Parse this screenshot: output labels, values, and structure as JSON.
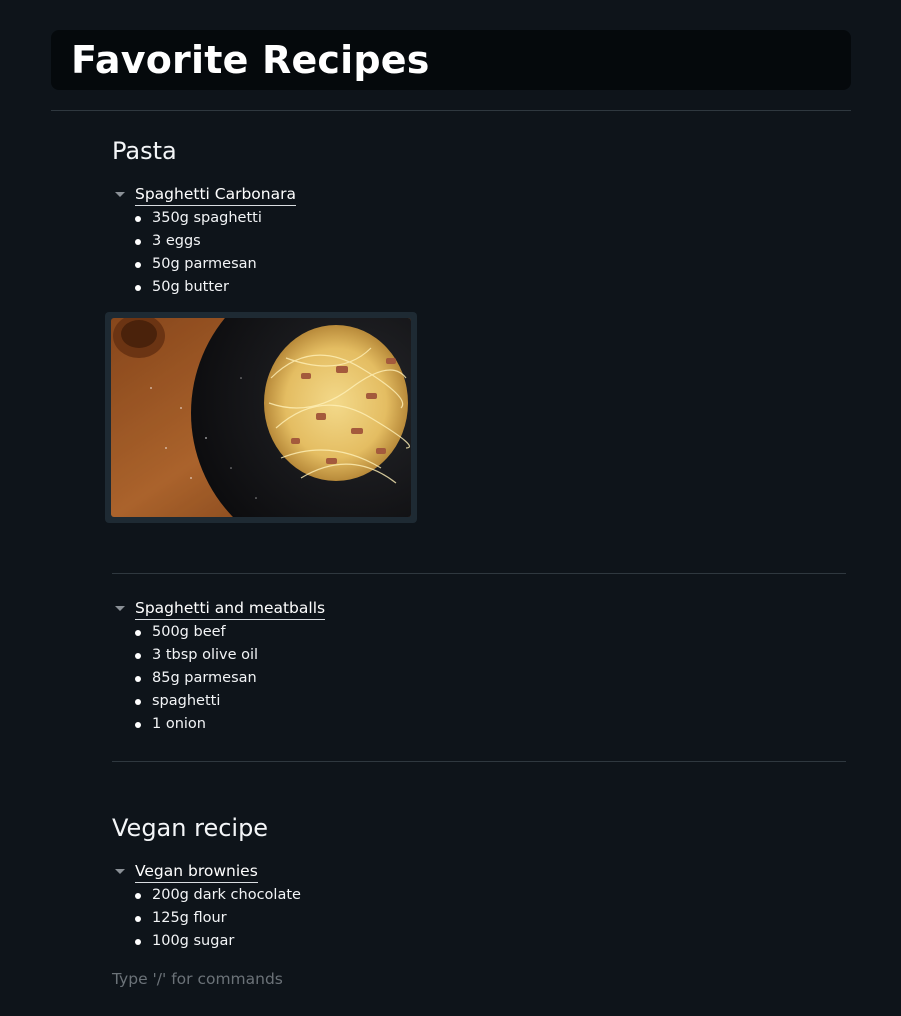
{
  "page": {
    "title": "Favorite Recipes"
  },
  "sections": [
    {
      "heading": "Pasta",
      "recipes": [
        {
          "title": "Spaghetti Carbonara",
          "ingredients": [
            "350g spaghetti",
            "3 eggs",
            "50g parmesan",
            "50g butter"
          ]
        },
        {
          "title": "Spaghetti and meatballs",
          "ingredients": [
            "500g beef",
            "3 tbsp olive oil",
            "85g parmesan",
            "spaghetti",
            "1 onion"
          ]
        }
      ]
    },
    {
      "heading": "Vegan recipe",
      "recipes": [
        {
          "title": "Vegan brownies",
          "ingredients": [
            "200g dark chocolate",
            "125g flour",
            "100g sugar"
          ]
        }
      ]
    }
  ],
  "editor": {
    "placeholder": "Type '/' for commands"
  },
  "icons": {
    "toggle": "caret-down-icon",
    "bullet": "bullet-dot-icon"
  },
  "colors": {
    "background": "#0e141a",
    "title_bar": "#05090c",
    "divider": "#2f383f",
    "placeholder": "#6b7278"
  }
}
